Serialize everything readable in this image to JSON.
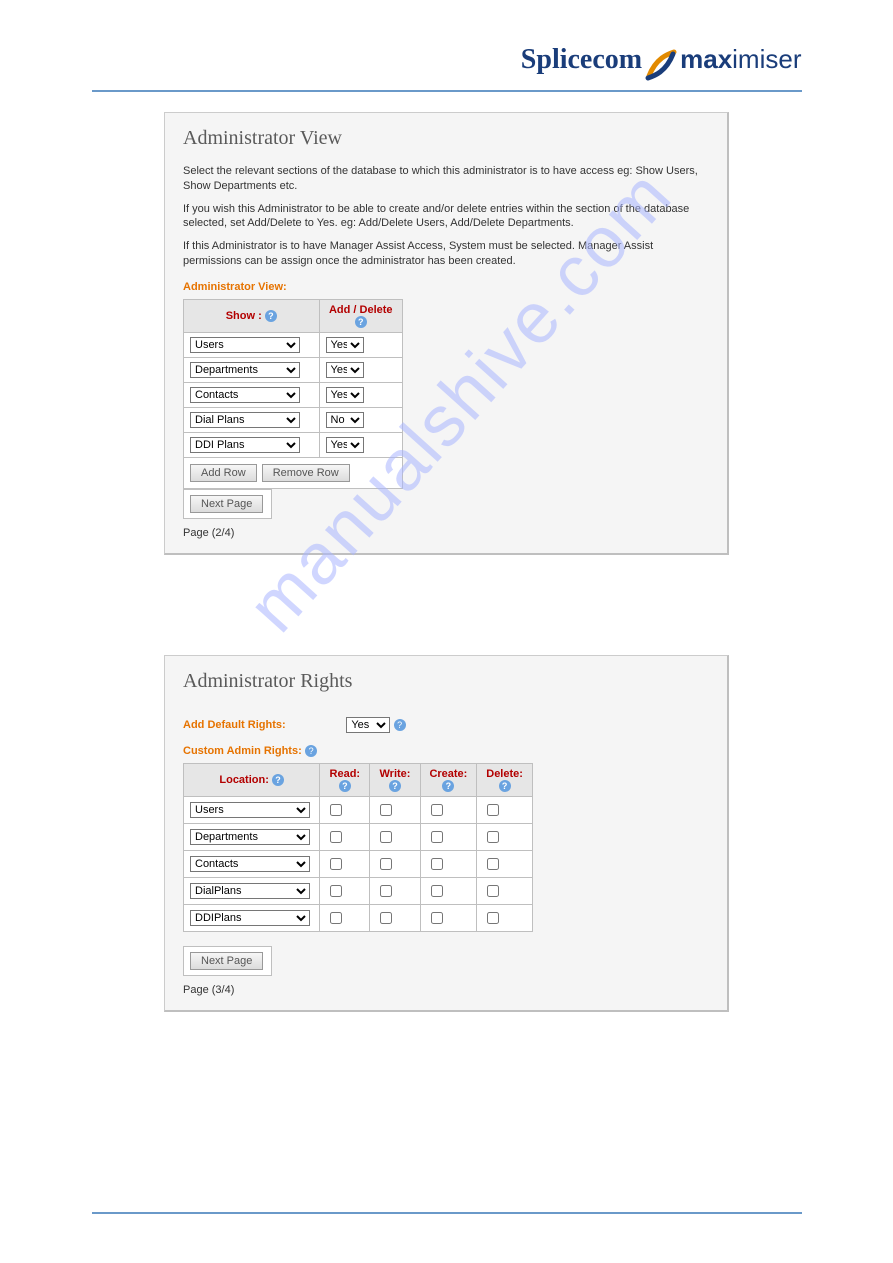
{
  "logo": {
    "splice": "Splicecom",
    "max": "max",
    "imiser": "imiser"
  },
  "watermark": "manualshive.com",
  "panel1": {
    "title": "Administrator View",
    "p1": "Select the relevant sections of the database to which this administrator is to have access eg: Show Users, Show Departments etc.",
    "p2": "If you wish this Administrator to be able to create and/or delete entries within the section of the database selected, set Add/Delete to Yes. eg: Add/Delete Users, Add/Delete Departments.",
    "p3": "If this Administrator is to have Manager Assist Access, System must be selected. Manager Assist permissions can be assign once the administrator has been created.",
    "view_label": "Administrator View:",
    "headers": {
      "show": "Show :",
      "adddel": "Add / Delete"
    },
    "rows": [
      {
        "show": "Users",
        "adddel": "Yes"
      },
      {
        "show": "Departments",
        "adddel": "Yes"
      },
      {
        "show": "Contacts",
        "adddel": "Yes"
      },
      {
        "show": "Dial Plans",
        "adddel": "No"
      },
      {
        "show": "DDI Plans",
        "adddel": "Yes"
      }
    ],
    "buttons": {
      "addrow": "Add Row",
      "removerow": "Remove Row",
      "next": "Next Page"
    },
    "pager": "Page (2/4)"
  },
  "panel2": {
    "title": "Administrator Rights",
    "add_default_label": "Add Default Rights:",
    "add_default_value": "Yes",
    "custom_label": "Custom Admin Rights:",
    "headers": {
      "location": "Location:",
      "read": "Read:",
      "write": "Write:",
      "create": "Create:",
      "delete": "Delete:"
    },
    "rows": [
      {
        "location": "Users"
      },
      {
        "location": "Departments"
      },
      {
        "location": "Contacts"
      },
      {
        "location": "DialPlans"
      },
      {
        "location": "DDIPlans"
      }
    ],
    "buttons": {
      "next": "Next Page"
    },
    "pager": "Page (3/4)"
  }
}
